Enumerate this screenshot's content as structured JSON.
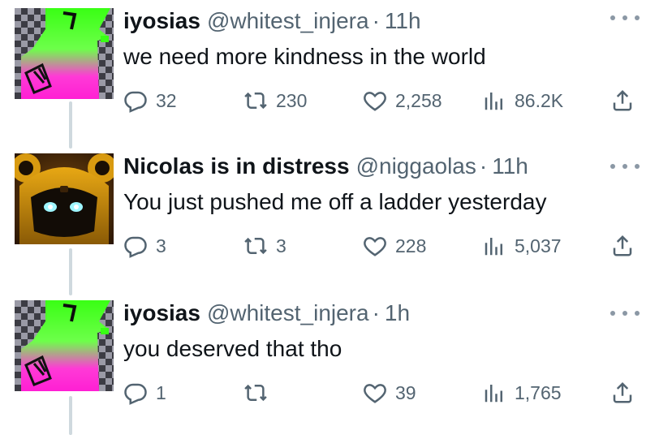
{
  "tweets": [
    {
      "display_name": "iyosias",
      "handle": "@whitest_injera",
      "separator": "·",
      "time": "11h",
      "text": "we need more kindness in the world",
      "avatar": "checkered-cartoon-avatar",
      "replies": "32",
      "retweets": "230",
      "likes": "2,258",
      "views": "86.2K"
    },
    {
      "display_name": "Nicolas is in distress",
      "handle": "@niggaolas",
      "separator": "·",
      "time": "11h",
      "text": "You just pushed me off a ladder yesterday",
      "avatar": "bear-robot-avatar",
      "replies": "3",
      "retweets": "3",
      "likes": "228",
      "views": "5,037"
    },
    {
      "display_name": "iyosias",
      "handle": "@whitest_injera",
      "separator": "·",
      "time": "1h",
      "text": "you deserved that tho",
      "avatar": "checkered-cartoon-avatar",
      "replies": "1",
      "retweets": "",
      "likes": "39",
      "views": "1,765"
    }
  ],
  "icons": {
    "reply": "reply-icon",
    "retweet": "retweet-icon",
    "like": "like-icon",
    "views": "views-icon",
    "share": "share-icon",
    "more": "more-icon"
  },
  "colors": {
    "text": "#0f1419",
    "secondary": "#536471",
    "thread_line": "#cfd9de",
    "avatar_green": "#39ff14",
    "avatar_pink": "#ff1fd4"
  }
}
